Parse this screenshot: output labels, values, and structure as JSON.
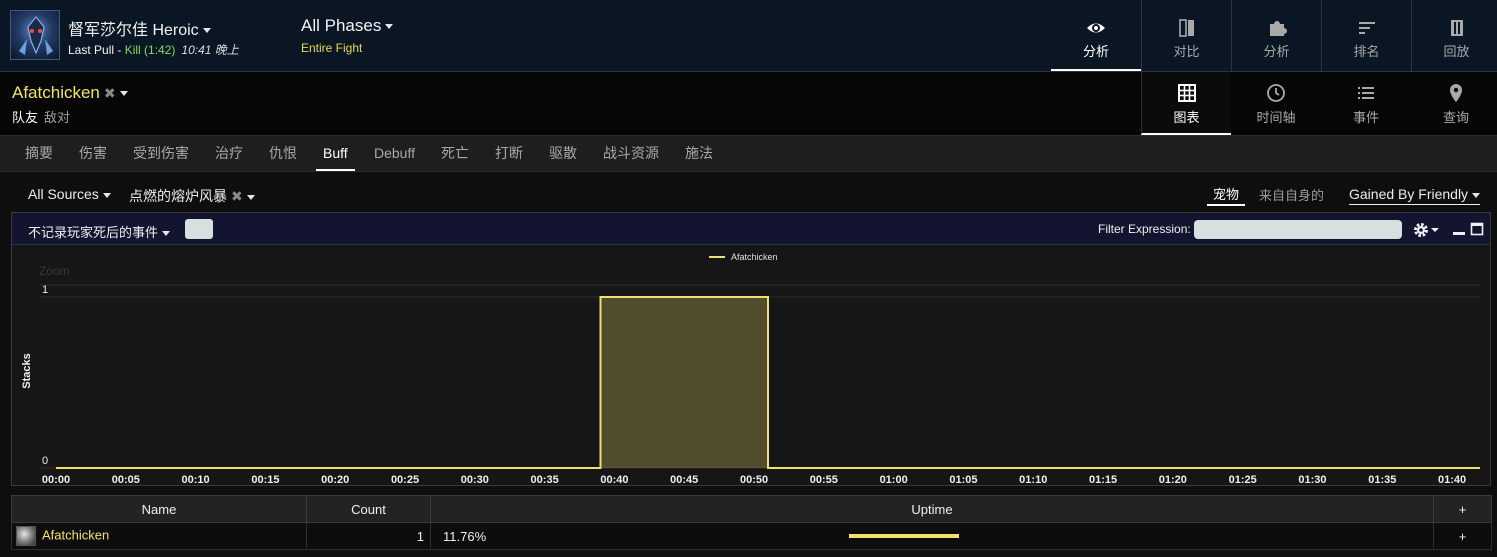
{
  "header": {
    "boss_title": "督军莎尔佳 Heroic",
    "last_pull_label": "Last Pull - ",
    "kill_text": "Kill (1:42)",
    "pull_time": "10:41 晚上",
    "phase": "All Phases",
    "fight_range": "Entire Fight",
    "top_tabs": [
      {
        "label": "分析",
        "icon": "eye-icon"
      },
      {
        "label": "对比",
        "icon": "compare-icon"
      },
      {
        "label": "分析",
        "icon": "puzzle-icon"
      },
      {
        "label": "排名",
        "icon": "ranking-icon"
      },
      {
        "label": "回放",
        "icon": "replay-icon"
      }
    ]
  },
  "subheader": {
    "player": "Afatchicken",
    "friendly": "队友",
    "enemy": "敌对",
    "tabs": [
      {
        "label": "图表",
        "icon": "grid-icon"
      },
      {
        "label": "时间轴",
        "icon": "clock-icon"
      },
      {
        "label": "事件",
        "icon": "list-icon"
      },
      {
        "label": "查询",
        "icon": "map-pin-icon"
      }
    ]
  },
  "view_tabs": [
    "摘要",
    "伤害",
    "受到伤害",
    "治疗",
    "仇恨",
    "Buff",
    "Debuff",
    "死亡",
    "打断",
    "驱散",
    "战斗资源",
    "施法"
  ],
  "active_view_tab": "Buff",
  "filters": {
    "sources": "All Sources",
    "aura": "点燃的熔炉风暴",
    "pet_toggle": "宠物",
    "self_toggle": "来自自身的",
    "gained": "Gained By Friendly"
  },
  "panel": {
    "dead_filter": "不记录玩家死后的事件",
    "filter_label": "Filter Expression:",
    "filter_value": ""
  },
  "chart_data": {
    "type": "area",
    "ylabel": "Stacks",
    "xlabel": "",
    "zoom_label": "Zoom",
    "legend": "top-center",
    "series": [
      {
        "name": "Afatchicken",
        "color": "#f0e070",
        "points": [
          [
            "00:00",
            0
          ],
          [
            "00:39",
            0
          ],
          [
            "00:39",
            1
          ],
          [
            "00:51",
            1
          ],
          [
            "00:51",
            0
          ],
          [
            "01:42",
            0
          ]
        ]
      }
    ],
    "y_ticks": [
      0,
      1
    ],
    "ylim": [
      0,
      2
    ],
    "x_ticks": [
      "00:00",
      "00:05",
      "00:10",
      "00:15",
      "00:20",
      "00:25",
      "00:30",
      "00:35",
      "00:40",
      "00:45",
      "00:50",
      "00:55",
      "01:00",
      "01:05",
      "01:10",
      "01:15",
      "01:20",
      "01:25",
      "01:30",
      "01:35",
      "01:40"
    ],
    "xlim_seconds": [
      0,
      102
    ]
  },
  "table": {
    "headers": [
      "Name",
      "Count",
      "Uptime",
      "+"
    ],
    "rows": [
      {
        "name": "Afatchicken",
        "count": "1",
        "uptime": "11.76%",
        "uptime_fraction": 0.1176,
        "plus": "+"
      }
    ]
  }
}
